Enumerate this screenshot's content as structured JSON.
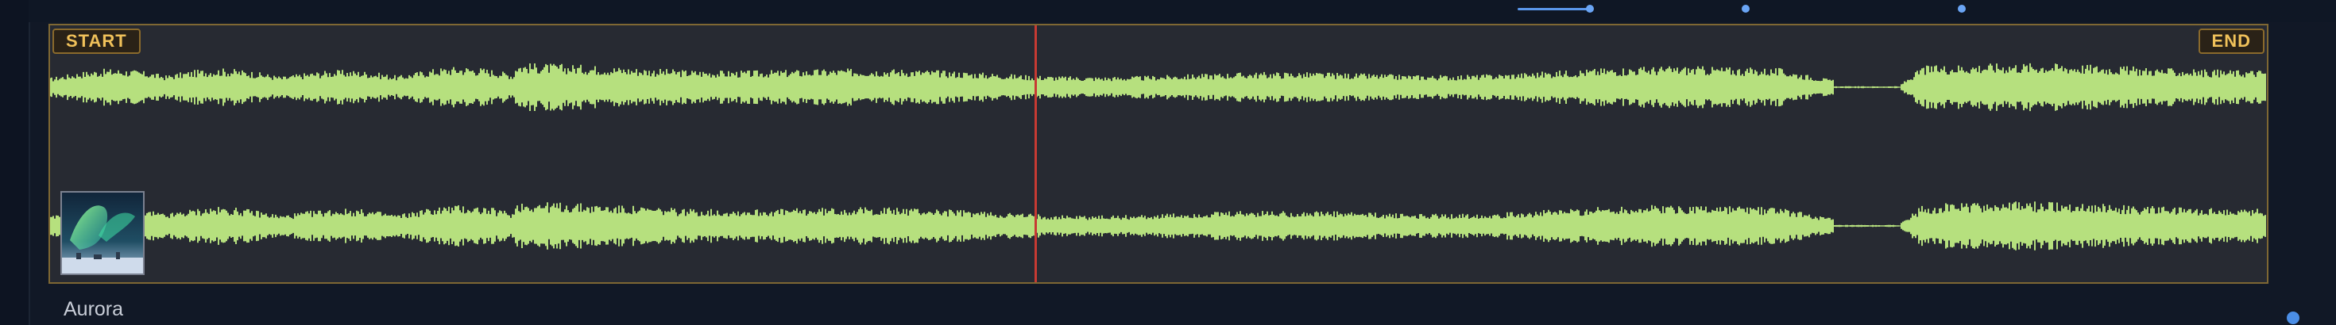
{
  "track": {
    "title": "Aurora",
    "start_label": "START",
    "end_label": "END",
    "cover_icon": "aurora-cover-art"
  },
  "playhead": {
    "position_fraction": 0.444
  },
  "top_sliders": [
    {
      "name": "slider-1",
      "value": 0.5
    },
    {
      "name": "slider-2",
      "value": 0.0
    },
    {
      "name": "slider-3",
      "value": 0.0
    }
  ],
  "colors": {
    "waveform": "#b6e07e",
    "playhead": "#c73a33",
    "marker_text": "#f0c15a",
    "marker_border": "#8a6a2c",
    "editor_bg": "#272a32",
    "app_bg": "#111826"
  }
}
